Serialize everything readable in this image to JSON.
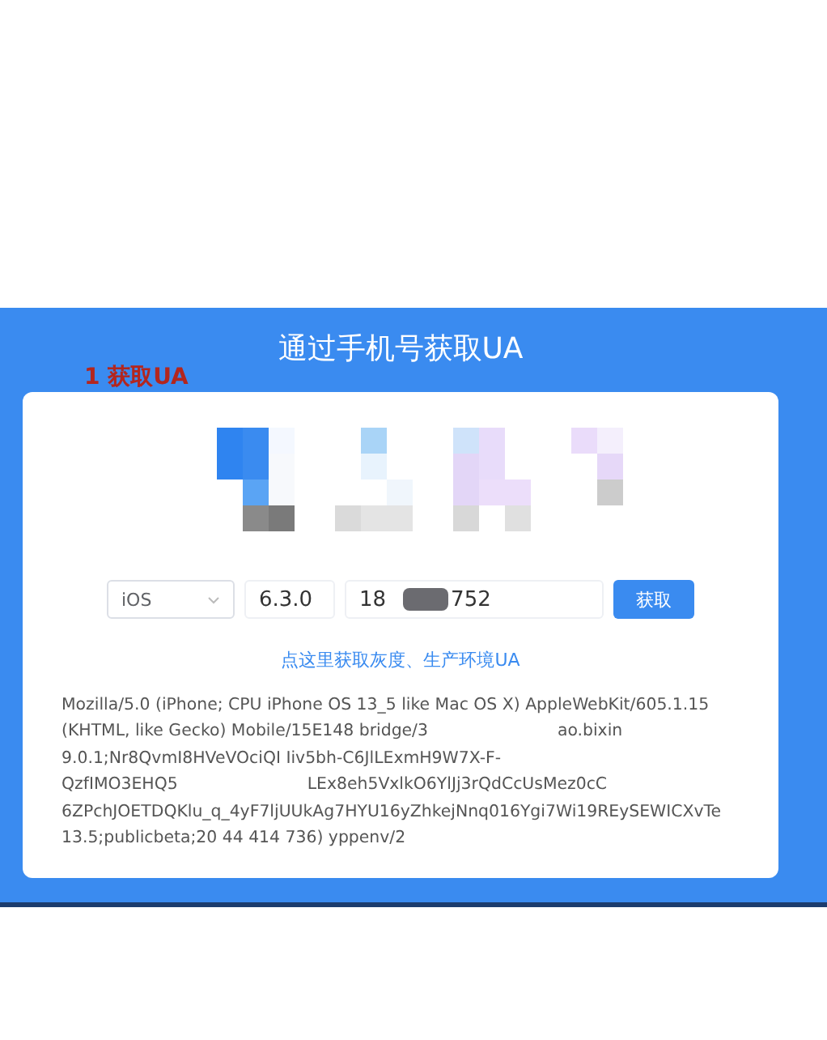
{
  "header": {
    "title": "通过手机号获取UA"
  },
  "annotation": "1 获取UA",
  "app_icons": [
    {
      "kind": "blurred"
    },
    {
      "kind": "blurred"
    },
    {
      "kind": "blurred"
    },
    {
      "kind": "blurred"
    }
  ],
  "form": {
    "platform": "iOS",
    "version": "6.3.0",
    "phone_start": "18",
    "phone_end": "752",
    "button": "获取"
  },
  "link": "点这里获取灰度、生产环境UA",
  "ua_lines": [
    [
      "Mozilla/5.0 (iPhone; CPU iPhone OS 13_5 like Mac OS X) AppleWebKit/605.1.15"
    ],
    [
      "(KHTML, like Gecko) Mobile/15E148 bridge/3",
      "ao.bixin"
    ],
    [
      "9.0.1;Nr8QvmI8HVeVOciQI  Iiv5bh-C6JlLExmH9W7X-F-"
    ],
    [
      "QzfIMO3EHQ5",
      "LEx8eh5VxlkO6YlJj3rQdCcUsMez0cC"
    ],
    [
      "6ZPchJOETDQKlu_q_4yF7ljUUkAg7HYU16yZhkejNnq016Ygi7Wi19REySEWICXvTe"
    ],
    [
      "13.5;publicbeta;20 44 414 736) yppenv/2"
    ]
  ]
}
